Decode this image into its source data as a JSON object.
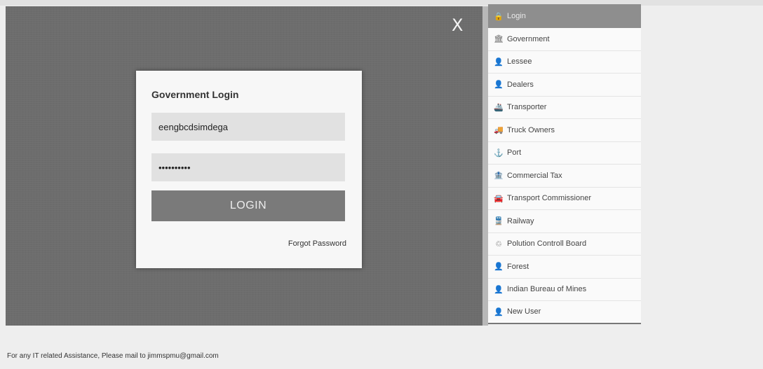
{
  "close_symbol": "X",
  "modal": {
    "title": "Government Login",
    "username_value": "eengbcdsimdega",
    "password_value": "••••••••••",
    "login_label": "LOGIN",
    "forgot_label": "Forgot Password"
  },
  "sidebar": {
    "items": [
      {
        "label": "Login",
        "icon": "lock-icon",
        "glyph": "🔒"
      },
      {
        "label": "Government",
        "icon": "building-icon",
        "glyph": "🏛"
      },
      {
        "label": "Lessee",
        "icon": "user-icon",
        "glyph": "👤"
      },
      {
        "label": "Dealers",
        "icon": "user-icon",
        "glyph": "👤"
      },
      {
        "label": "Transporter",
        "icon": "ship-icon",
        "glyph": "🚢"
      },
      {
        "label": "Truck Owners",
        "icon": "truck-icon",
        "glyph": "🚚"
      },
      {
        "label": "Port",
        "icon": "anchor-icon",
        "glyph": "⚓"
      },
      {
        "label": "Commercial Tax",
        "icon": "bank-icon",
        "glyph": "🏦"
      },
      {
        "label": "Transport Commissioner",
        "icon": "car-icon",
        "glyph": "🚘"
      },
      {
        "label": "Railway",
        "icon": "train-icon",
        "glyph": "🚆"
      },
      {
        "label": "Polution Controll Board",
        "icon": "leaf-icon",
        "glyph": "♲"
      },
      {
        "label": "Forest",
        "icon": "user-icon",
        "glyph": "👤"
      },
      {
        "label": "Indian Bureau of Mines",
        "icon": "user-icon",
        "glyph": "👤"
      },
      {
        "label": "New User",
        "icon": "user-icon",
        "glyph": "👤"
      }
    ]
  },
  "footer": {
    "text": "For any IT related Assistance, Please mail to jimmspmu@gmail.com"
  },
  "colors": {
    "overlay": "#6d6d6d",
    "button": "#7a7a7a",
    "active_item": "#8e8e8e"
  }
}
